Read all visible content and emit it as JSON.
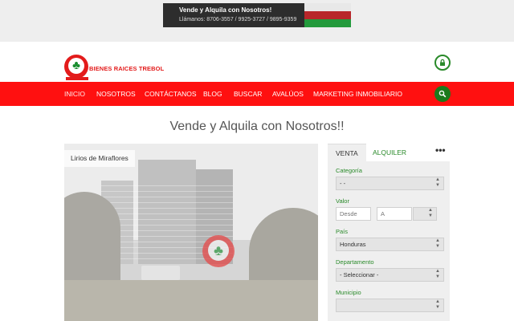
{
  "banner": {
    "headline": "Vende y Alquila con Nosotros!",
    "phones": "Llámanos:  8706-3557 / 9925-3727  / 9895-9359"
  },
  "logo": {
    "text": "BIENES RAICES TREBOL"
  },
  "nav": {
    "items": [
      "INICIO",
      "NOSOTROS",
      "CONTÁCTANOS",
      "BLOG",
      "BUSCAR",
      "AVALÚOS",
      "MARKETING INMOBILIARIO"
    ]
  },
  "page": {
    "title": "Vende y Alquila con Nosotros!!"
  },
  "gallery": {
    "caption": "Lirios de Miraflores"
  },
  "search": {
    "tabs": [
      "VENTA",
      "ALQUILER"
    ],
    "more": "•••",
    "categoria": {
      "label": "Categoría",
      "value": "- -"
    },
    "valor": {
      "label": "Valor",
      "from_placeholder": "Desde",
      "to_placeholder": "A",
      "currency": ""
    },
    "pais": {
      "label": "País",
      "value": "Honduras"
    },
    "departamento": {
      "label": "Departamento",
      "value": "- Seleccionar -"
    },
    "municipio": {
      "label": "Municipio",
      "value": ""
    }
  },
  "colors": {
    "brand_red": "#ff1010",
    "brand_green": "#2a8a2a"
  },
  "icons": {
    "lock": "lock-icon",
    "search": "search-icon",
    "clover": "clover-icon"
  }
}
